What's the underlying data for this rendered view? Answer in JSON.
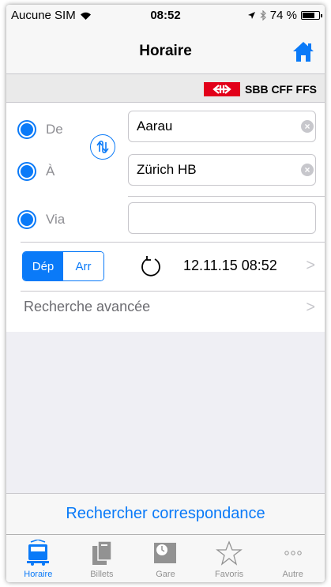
{
  "status_bar": {
    "carrier": "Aucune SIM",
    "time": "08:52",
    "battery": "74 %",
    "battery_level": 0.74
  },
  "nav": {
    "title": "Horaire"
  },
  "brand": {
    "name": "SBB CFF FFS"
  },
  "form": {
    "from_label": "De",
    "from_value": "Aarau",
    "to_label": "À",
    "to_value": "Zürich HB",
    "via_label": "Via",
    "via_value": "",
    "mode_dep": "Dép",
    "mode_arr": "Arr",
    "datetime": "12.11.15 08:52",
    "advanced": "Recherche avancée"
  },
  "search_button": "Rechercher correspondance",
  "tabs": [
    {
      "label": "Horaire",
      "icon": "train-icon",
      "active": true
    },
    {
      "label": "Billets",
      "icon": "tickets-icon",
      "active": false
    },
    {
      "label": "Gare",
      "icon": "station-clock-icon",
      "active": false
    },
    {
      "label": "Favoris",
      "icon": "star-icon",
      "active": false
    },
    {
      "label": "Autre",
      "icon": "more-icon",
      "active": false
    }
  ],
  "colors": {
    "accent": "#0a7af8",
    "brand_red": "#e2001a"
  }
}
